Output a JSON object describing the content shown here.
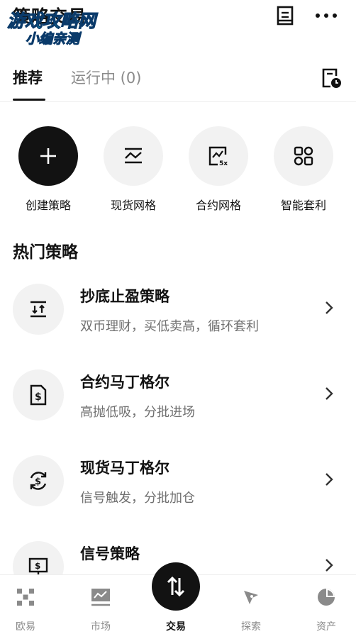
{
  "header": {
    "title": "策略交易",
    "watermark_line1": "游戏攻略网",
    "watermark_line2": "小编亲测",
    "book_icon": "book-icon",
    "more_icon": "more-icon"
  },
  "tabs": {
    "recommended": "推荐",
    "running": "运行中 (0)",
    "history_icon": "document-clock-icon"
  },
  "quick_actions": [
    {
      "label": "创建策略",
      "icon": "plus-icon"
    },
    {
      "label": "现货网格",
      "icon": "grid-chart-icon"
    },
    {
      "label": "合约网格",
      "icon": "leverage-grid-icon"
    },
    {
      "label": "智能套利",
      "icon": "arbitrage-icon"
    }
  ],
  "section": {
    "hot_title": "热门策略"
  },
  "strategies": [
    {
      "title": "抄底止盈策略",
      "desc": "双币理财，买低卖高，循环套利",
      "icon": "buy-low-sell-high-icon"
    },
    {
      "title": "合约马丁格尔",
      "desc": "高抛低吸，分批进场",
      "icon": "contract-doc-dollar-icon"
    },
    {
      "title": "现货马丁格尔",
      "desc": "信号触发，分批加仓",
      "icon": "cycle-dollar-icon"
    },
    {
      "title": "信号策略",
      "desc": "",
      "icon": "signal-monitor-icon"
    }
  ],
  "bottom_nav": [
    {
      "label": "欧易",
      "icon": "okx-logo-icon"
    },
    {
      "label": "市场",
      "icon": "market-chart-icon"
    },
    {
      "label": "交易",
      "icon": "trade-arrows-icon"
    },
    {
      "label": "探索",
      "icon": "explore-compass-icon"
    },
    {
      "label": "资产",
      "icon": "assets-pie-icon"
    }
  ],
  "colors": {
    "primary_text": "#121212",
    "secondary_text": "#6f6f6f",
    "muted_text": "#8a8a8a",
    "icon_bg": "#f2f2f2",
    "watermark": "#1ad0e6"
  }
}
